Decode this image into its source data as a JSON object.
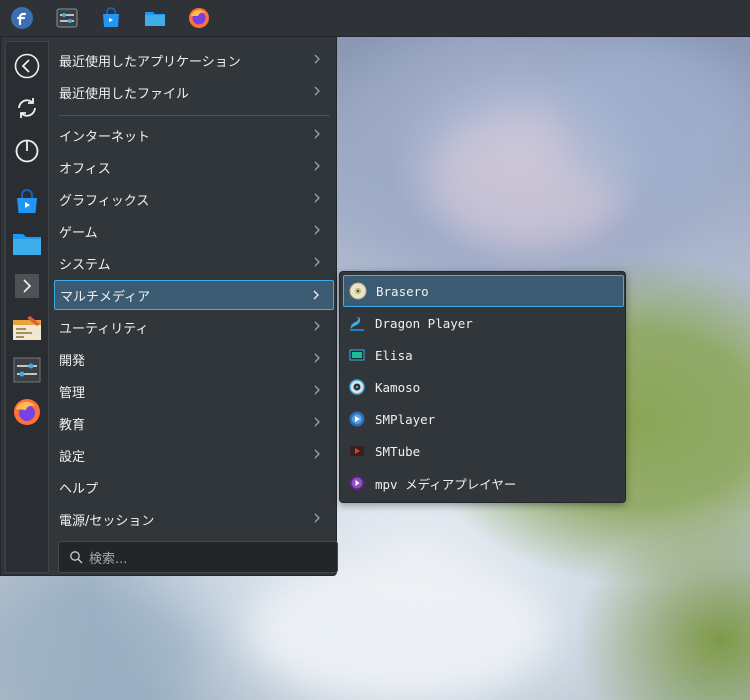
{
  "taskbar": {
    "items": [
      {
        "name": "fedora-launcher-icon"
      },
      {
        "name": "system-settings-icon"
      },
      {
        "name": "discover-store-icon"
      },
      {
        "name": "file-manager-icon"
      },
      {
        "name": "firefox-icon"
      }
    ]
  },
  "favorites": [
    {
      "name": "back-icon"
    },
    {
      "name": "restart-icon"
    },
    {
      "name": "power-icon"
    },
    {
      "name": "discover-store-icon"
    },
    {
      "name": "folder-icon"
    },
    {
      "name": "terminal-icon"
    },
    {
      "name": "text-editor-icon"
    },
    {
      "name": "settings-sliders-icon"
    },
    {
      "name": "firefox-icon"
    }
  ],
  "menu": {
    "recent_apps": "最近使用したアプリケーション",
    "recent_files": "最近使用したファイル",
    "categories": [
      {
        "label": "インターネット",
        "key": "internet"
      },
      {
        "label": "オフィス",
        "key": "office"
      },
      {
        "label": "グラフィックス",
        "key": "graphics"
      },
      {
        "label": "ゲーム",
        "key": "games"
      },
      {
        "label": "システム",
        "key": "system"
      },
      {
        "label": "マルチメディア",
        "key": "multimedia"
      },
      {
        "label": "ユーティリティ",
        "key": "utilities"
      },
      {
        "label": "開発",
        "key": "development"
      },
      {
        "label": "管理",
        "key": "administration"
      },
      {
        "label": "教育",
        "key": "education"
      },
      {
        "label": "設定",
        "key": "settings"
      },
      {
        "label": "ヘルプ",
        "key": "help"
      },
      {
        "label": "電源/セッション",
        "key": "power-session"
      }
    ]
  },
  "search": {
    "placeholder": "検索..."
  },
  "submenu": {
    "items": [
      {
        "label": "Brasero",
        "icon": "brasero-disc-icon"
      },
      {
        "label": "Dragon Player",
        "icon": "dragon-player-icon"
      },
      {
        "label": "Elisa",
        "icon": "elisa-icon"
      },
      {
        "label": "Kamoso",
        "icon": "kamoso-camera-icon"
      },
      {
        "label": "SMPlayer",
        "icon": "smplayer-icon"
      },
      {
        "label": "SMTube",
        "icon": "smtube-icon"
      },
      {
        "label": "mpv メディアプレイヤー",
        "icon": "mpv-icon"
      }
    ]
  },
  "colors": {
    "accent": "#3daee9",
    "panel": "#31363b",
    "highlight": "#3a5b72"
  }
}
